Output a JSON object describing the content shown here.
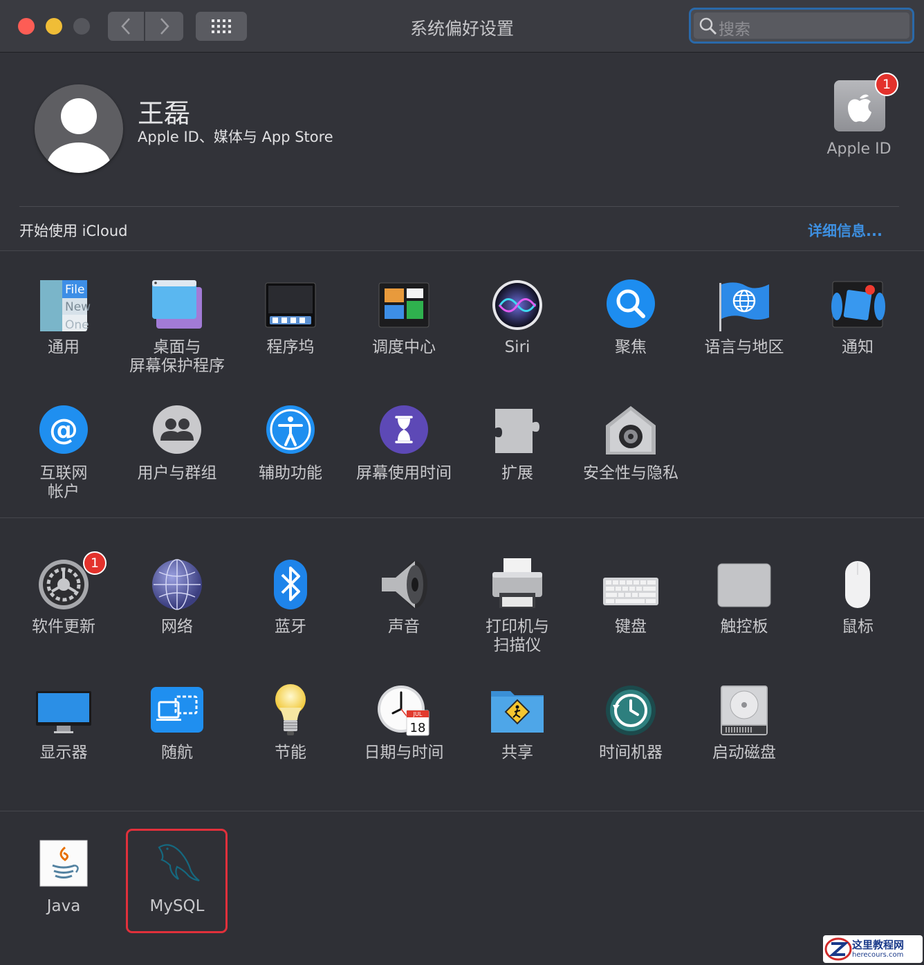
{
  "window": {
    "title": "系统偏好设置",
    "search_placeholder": "搜索"
  },
  "account": {
    "name": "王磊",
    "subtitle": "Apple ID、媒体与 App Store",
    "apple_id_label": "Apple ID",
    "apple_id_badge": "1"
  },
  "icloud_bar": {
    "text": "开始使用 iCloud",
    "details_link": "详细信息..."
  },
  "panes_row1": [
    {
      "label": "通用",
      "icon": "general-icon"
    },
    {
      "label": "桌面与\n屏幕保护程序",
      "icon": "desktop-screensaver-icon"
    },
    {
      "label": "程序坞",
      "icon": "dock-icon"
    },
    {
      "label": "调度中心",
      "icon": "mission-control-icon"
    },
    {
      "label": "Siri",
      "icon": "siri-icon"
    },
    {
      "label": "聚焦",
      "icon": "spotlight-icon"
    },
    {
      "label": "语言与地区",
      "icon": "language-region-icon"
    },
    {
      "label": "通知",
      "icon": "notifications-icon"
    }
  ],
  "general_icon_text": {
    "file": "File",
    "new": "New",
    "one": "One"
  },
  "panes_row2": [
    {
      "label": "互联网\n帐户",
      "icon": "internet-accounts-icon"
    },
    {
      "label": "用户与群组",
      "icon": "users-groups-icon"
    },
    {
      "label": "辅助功能",
      "icon": "accessibility-icon"
    },
    {
      "label": "屏幕使用时间",
      "icon": "screen-time-icon"
    },
    {
      "label": "扩展",
      "icon": "extensions-icon"
    },
    {
      "label": "安全性与隐私",
      "icon": "security-privacy-icon"
    }
  ],
  "panes_row3": [
    {
      "label": "软件更新",
      "icon": "software-update-icon",
      "badge": "1"
    },
    {
      "label": "网络",
      "icon": "network-icon"
    },
    {
      "label": "蓝牙",
      "icon": "bluetooth-icon"
    },
    {
      "label": "声音",
      "icon": "sound-icon"
    },
    {
      "label": "打印机与\n扫描仪",
      "icon": "printers-scanners-icon"
    },
    {
      "label": "键盘",
      "icon": "keyboard-icon"
    },
    {
      "label": "触控板",
      "icon": "trackpad-icon"
    },
    {
      "label": "鼠标",
      "icon": "mouse-icon"
    }
  ],
  "panes_row4": [
    {
      "label": "显示器",
      "icon": "displays-icon"
    },
    {
      "label": "随航",
      "icon": "sidecar-icon"
    },
    {
      "label": "节能",
      "icon": "energy-saver-icon"
    },
    {
      "label": "日期与时间",
      "icon": "date-time-icon"
    },
    {
      "label": "共享",
      "icon": "sharing-icon"
    },
    {
      "label": "时间机器",
      "icon": "time-machine-icon"
    },
    {
      "label": "启动磁盘",
      "icon": "startup-disk-icon"
    }
  ],
  "calendar_icon": {
    "month": "JUL",
    "day": "18"
  },
  "panes_row5": [
    {
      "label": "Java",
      "icon": "java-icon"
    },
    {
      "label": "MySQL",
      "icon": "mysql-icon"
    }
  ],
  "watermark": {
    "title": "这里教程网",
    "url": "herecours.com"
  },
  "colors": {
    "accent": "#3d8fe0",
    "highlight": "#e1303b",
    "badge": "#e3322c"
  }
}
